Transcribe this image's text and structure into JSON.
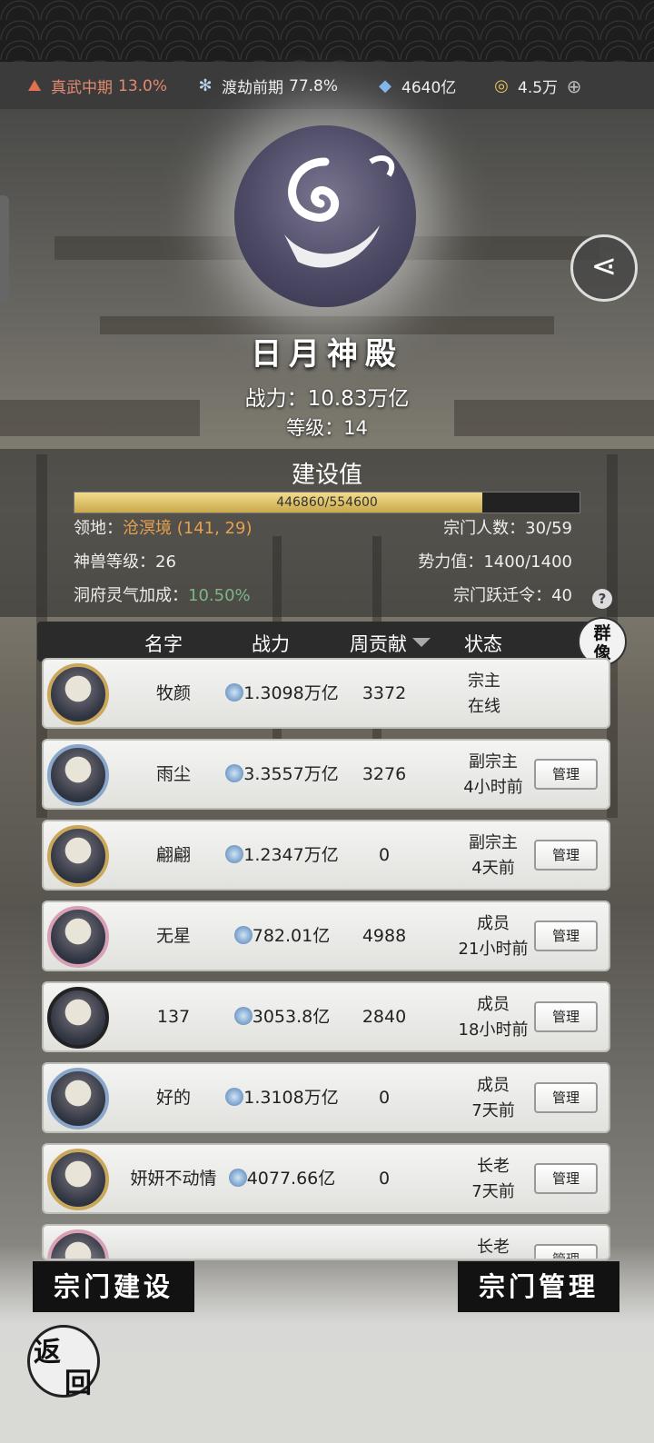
{
  "resources": {
    "realm1": {
      "label": "真武中期",
      "pct": "13.0%"
    },
    "realm2": {
      "label": "渡劫前期",
      "pct": "77.8%"
    },
    "crystal": "4640亿",
    "coins": "4.5万"
  },
  "sect": {
    "name": "日月神殿",
    "power": "战力：10.83万亿",
    "level": "等级：14",
    "build_title": "建设值",
    "build_progress": 0.807,
    "build_text": "446860/554600",
    "territory_label": "领地：",
    "territory_value": "沧溟境 (141, 29)",
    "members_label": "宗门人数：",
    "members_value": "30/59",
    "beast_label": "神兽等级：",
    "beast_value": "26",
    "influence_label": "势力值：",
    "influence_value": "1400/1400",
    "cave_label": "洞府灵气加成：",
    "cave_value": "10.50%",
    "token_label": "宗门跃迁令：",
    "token_value": "40",
    "help": "?"
  },
  "table": {
    "headers": {
      "name": "名字",
      "power": "战力",
      "contrib": "周贡献",
      "status": "状态"
    },
    "portrait": [
      "群",
      "像"
    ],
    "manage_label": "管理",
    "rows": [
      {
        "name": "牧颜",
        "power": "1.3098万亿",
        "contrib": "3372",
        "role": "宗主",
        "time": "在线",
        "manage": false
      },
      {
        "name": "雨尘",
        "power": "3.3557万亿",
        "contrib": "3276",
        "role": "副宗主",
        "time": "4小时前",
        "manage": true
      },
      {
        "name": "翩翩",
        "power": "1.2347万亿",
        "contrib": "0",
        "role": "副宗主",
        "time": "4天前",
        "manage": true
      },
      {
        "name": "无星",
        "power": "782.01亿",
        "contrib": "4988",
        "role": "成员",
        "time": "21小时前",
        "manage": true
      },
      {
        "name": "137",
        "power": "3053.8亿",
        "contrib": "2840",
        "role": "成员",
        "time": "18小时前",
        "manage": true
      },
      {
        "name": "好的",
        "power": "1.3108万亿",
        "contrib": "0",
        "role": "成员",
        "time": "7天前",
        "manage": true
      },
      {
        "name": "妍妍不动情",
        "power": "4077.66亿",
        "contrib": "0",
        "role": "长老",
        "time": "7天前",
        "manage": true
      },
      {
        "name": "",
        "power": "",
        "contrib": "",
        "role": "长老",
        "time": "",
        "manage": true
      }
    ]
  },
  "buttons": {
    "build": "宗门建设",
    "manage": "宗门管理",
    "back": [
      "返",
      "回"
    ]
  },
  "colors": {
    "accent_orange": "#e6a050",
    "accent_green": "#7db58a",
    "bar_gold": "#c9a94a"
  }
}
